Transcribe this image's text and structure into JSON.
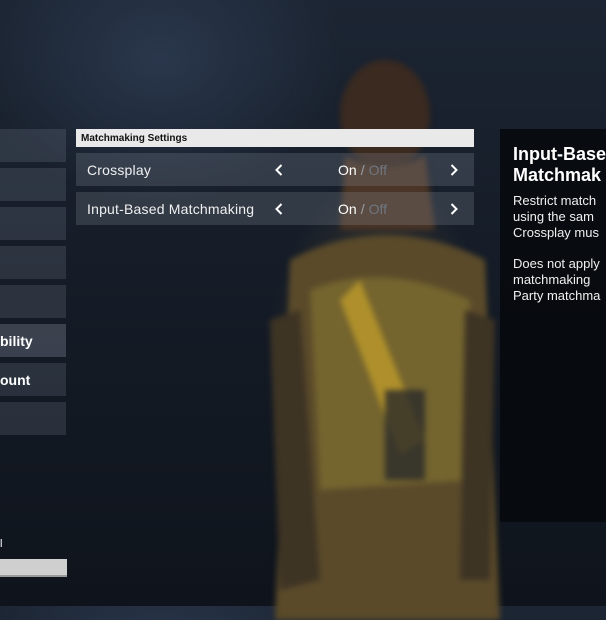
{
  "left_menu": {
    "items": [
      {
        "label": ""
      },
      {
        "label": ""
      },
      {
        "label": ""
      },
      {
        "label": ""
      },
      {
        "label": ""
      },
      {
        "label": "bility"
      },
      {
        "label": "ount"
      },
      {
        "label": ""
      }
    ]
  },
  "footer": {
    "label": "l"
  },
  "settings": {
    "section_title": "Matchmaking Settings",
    "rows": [
      {
        "name": "Crossplay",
        "on_label": "On",
        "separator": "/",
        "off_label": "Off",
        "selected": "On"
      },
      {
        "name": "Input-Based Matchmaking",
        "on_label": "On",
        "separator": "/",
        "off_label": "Off",
        "selected": "On"
      }
    ]
  },
  "info": {
    "title_line1": "Input-Base",
    "title_line2": "Matchmak",
    "para1": [
      "Restrict match",
      "using the sam",
      "Crossplay mus"
    ],
    "para2": [
      "Does not apply",
      "matchmaking",
      "Party matchma"
    ]
  },
  "icons": {
    "prev": "chevron-left-icon",
    "next": "chevron-right-icon"
  },
  "colors": {
    "section_header_bg": "#e9e9e9",
    "info_panel_bg": "#06080c",
    "off_text": "#6f7680"
  }
}
